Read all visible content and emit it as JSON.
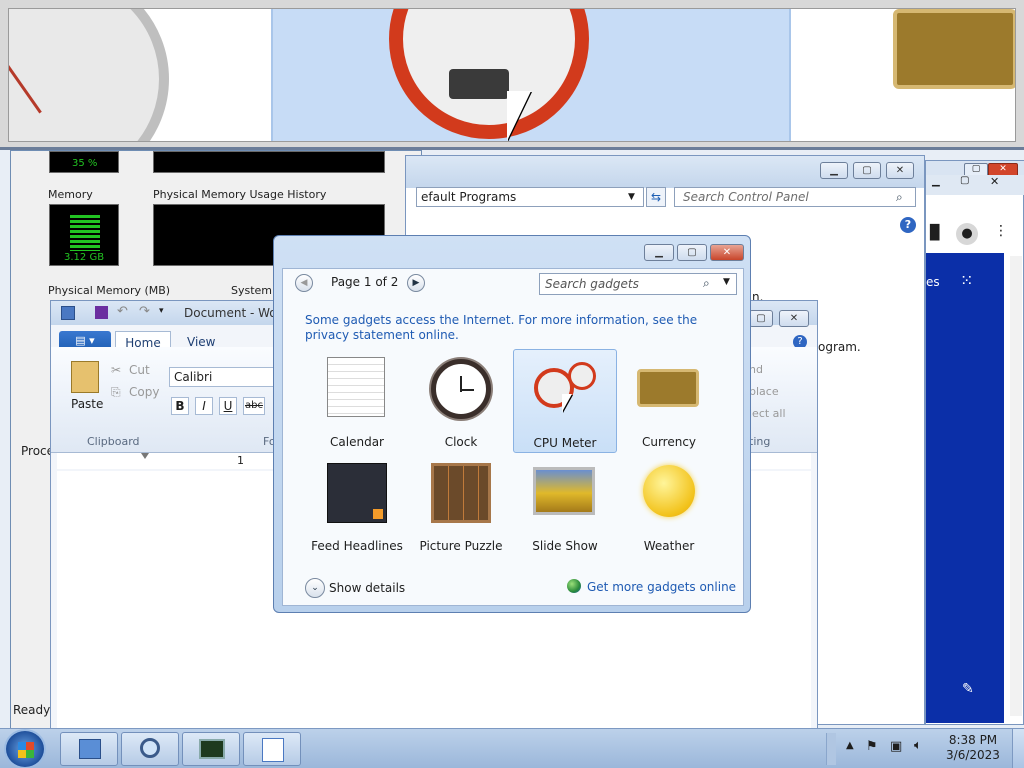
{
  "control_panel": {
    "address": "efault Programs",
    "search_placeholder": "Search Control Panel",
    "partial_text_1": "n.",
    "partial_text_2": "ogram."
  },
  "task_manager": {
    "cpu_percent": "35 %",
    "memory_label": "Memory",
    "memory_value": "3.12 GB",
    "history_label": "Physical Memory Usage History",
    "phys_mem_label": "Physical Memory (MB)",
    "system_label": "System",
    "processes_tab": "Proce"
  },
  "wordpad": {
    "title": "Document - Wor",
    "tabs": [
      "Home",
      "View"
    ],
    "cut": "Cut",
    "copy": "Copy",
    "paste": "Paste",
    "clipboard_group": "Clipboard",
    "font_group_partial": "Fo",
    "font_name": "Calibri",
    "editing_replace": "place",
    "editing_select": "lect all",
    "editing_find": "nd",
    "editing_group": "ting",
    "ruler_mark": "1",
    "status": "Ready"
  },
  "gadget_gallery": {
    "page_label": "Page 1 of 2",
    "search_placeholder": "Search gadgets",
    "info_text": "Some gadgets access the Internet.  For more information, see the privacy statement online.",
    "gadgets": [
      {
        "name": "Calendar"
      },
      {
        "name": "Clock"
      },
      {
        "name": "CPU Meter",
        "selected": true
      },
      {
        "name": "Currency"
      },
      {
        "name": "Feed Headlines"
      },
      {
        "name": "Picture Puzzle"
      },
      {
        "name": "Slide Show"
      },
      {
        "name": "Weather"
      }
    ],
    "show_details": "Show details",
    "get_more": "Get more gadgets online"
  },
  "taskbar": {
    "time": "8:38 PM",
    "date": "3/6/2023"
  },
  "colors": {
    "accent": "#1e5fb4",
    "link": "#1f5bb3",
    "graph_green": "#22c322"
  }
}
